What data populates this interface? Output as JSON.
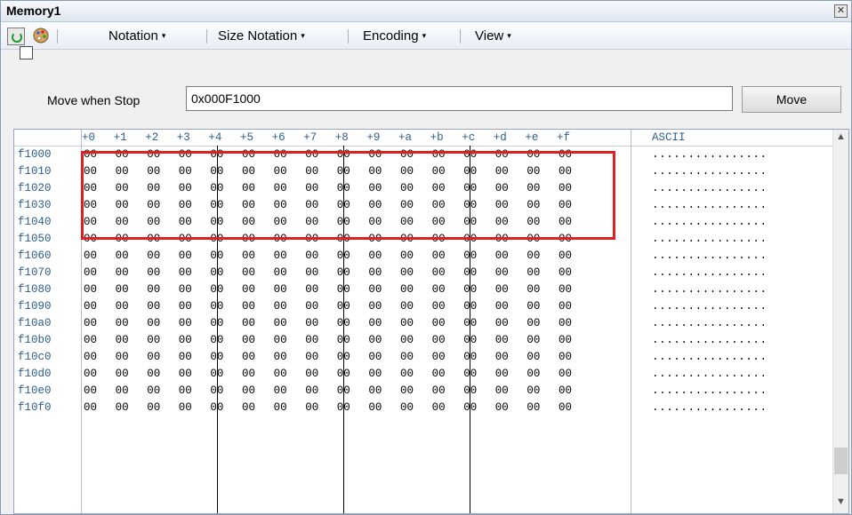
{
  "window": {
    "title": "Memory1"
  },
  "toolbar": {
    "icons": [
      "refresh-icon",
      "palette-icon"
    ],
    "menus": [
      {
        "label": "Notation",
        "arrow": "▾"
      },
      {
        "label": "Size Notation",
        "arrow": "▾"
      },
      {
        "label": "Encoding",
        "arrow": "▾"
      },
      {
        "label": "View",
        "arrow": "▾"
      }
    ]
  },
  "addressbar": {
    "checkbox_label": "Move when Stop",
    "checkbox_checked": false,
    "address_value": "0x000F1000",
    "move_button": "Move"
  },
  "grid": {
    "offset_headers": [
      "+0",
      "+1",
      "+2",
      "+3",
      "+4",
      "+5",
      "+6",
      "+7",
      "+8",
      "+9",
      "+a",
      "+b",
      "+c",
      "+d",
      "+e",
      "+f"
    ],
    "ascii_header": "ASCII",
    "rows": [
      {
        "address": "f1000",
        "bytes": [
          "00",
          "00",
          "00",
          "00",
          "00",
          "00",
          "00",
          "00",
          "00",
          "00",
          "00",
          "00",
          "00",
          "00",
          "00",
          "00"
        ],
        "ascii": "................"
      },
      {
        "address": "f1010",
        "bytes": [
          "00",
          "00",
          "00",
          "00",
          "00",
          "00",
          "00",
          "00",
          "00",
          "00",
          "00",
          "00",
          "00",
          "00",
          "00",
          "00"
        ],
        "ascii": "................"
      },
      {
        "address": "f1020",
        "bytes": [
          "00",
          "00",
          "00",
          "00",
          "00",
          "00",
          "00",
          "00",
          "00",
          "00",
          "00",
          "00",
          "00",
          "00",
          "00",
          "00"
        ],
        "ascii": "................"
      },
      {
        "address": "f1030",
        "bytes": [
          "00",
          "00",
          "00",
          "00",
          "00",
          "00",
          "00",
          "00",
          "00",
          "00",
          "00",
          "00",
          "00",
          "00",
          "00",
          "00"
        ],
        "ascii": "................"
      },
      {
        "address": "f1040",
        "bytes": [
          "00",
          "00",
          "00",
          "00",
          "00",
          "00",
          "00",
          "00",
          "00",
          "00",
          "00",
          "00",
          "00",
          "00",
          "00",
          "00"
        ],
        "ascii": "................"
      },
      {
        "address": "f1050",
        "bytes": [
          "00",
          "00",
          "00",
          "00",
          "00",
          "00",
          "00",
          "00",
          "00",
          "00",
          "00",
          "00",
          "00",
          "00",
          "00",
          "00"
        ],
        "ascii": "................"
      },
      {
        "address": "f1060",
        "bytes": [
          "00",
          "00",
          "00",
          "00",
          "00",
          "00",
          "00",
          "00",
          "00",
          "00",
          "00",
          "00",
          "00",
          "00",
          "00",
          "00"
        ],
        "ascii": "................"
      },
      {
        "address": "f1070",
        "bytes": [
          "00",
          "00",
          "00",
          "00",
          "00",
          "00",
          "00",
          "00",
          "00",
          "00",
          "00",
          "00",
          "00",
          "00",
          "00",
          "00"
        ],
        "ascii": "................"
      },
      {
        "address": "f1080",
        "bytes": [
          "00",
          "00",
          "00",
          "00",
          "00",
          "00",
          "00",
          "00",
          "00",
          "00",
          "00",
          "00",
          "00",
          "00",
          "00",
          "00"
        ],
        "ascii": "................"
      },
      {
        "address": "f1090",
        "bytes": [
          "00",
          "00",
          "00",
          "00",
          "00",
          "00",
          "00",
          "00",
          "00",
          "00",
          "00",
          "00",
          "00",
          "00",
          "00",
          "00"
        ],
        "ascii": "................"
      },
      {
        "address": "f10a0",
        "bytes": [
          "00",
          "00",
          "00",
          "00",
          "00",
          "00",
          "00",
          "00",
          "00",
          "00",
          "00",
          "00",
          "00",
          "00",
          "00",
          "00"
        ],
        "ascii": "................"
      },
      {
        "address": "f10b0",
        "bytes": [
          "00",
          "00",
          "00",
          "00",
          "00",
          "00",
          "00",
          "00",
          "00",
          "00",
          "00",
          "00",
          "00",
          "00",
          "00",
          "00"
        ],
        "ascii": "................"
      },
      {
        "address": "f10c0",
        "bytes": [
          "00",
          "00",
          "00",
          "00",
          "00",
          "00",
          "00",
          "00",
          "00",
          "00",
          "00",
          "00",
          "00",
          "00",
          "00",
          "00"
        ],
        "ascii": "................"
      },
      {
        "address": "f10d0",
        "bytes": [
          "00",
          "00",
          "00",
          "00",
          "00",
          "00",
          "00",
          "00",
          "00",
          "00",
          "00",
          "00",
          "00",
          "00",
          "00",
          "00"
        ],
        "ascii": "................"
      },
      {
        "address": "f10e0",
        "bytes": [
          "00",
          "00",
          "00",
          "00",
          "00",
          "00",
          "00",
          "00",
          "00",
          "00",
          "00",
          "00",
          "00",
          "00",
          "00",
          "00"
        ],
        "ascii": "................"
      },
      {
        "address": "f10f0",
        "bytes": [
          "00",
          "00",
          "00",
          "00",
          "00",
          "00",
          "00",
          "00",
          "00",
          "00",
          "00",
          "00",
          "00",
          "00",
          "00",
          "00"
        ],
        "ascii": "................"
      }
    ]
  },
  "highlight": {
    "color": "#e02020",
    "rows_covered": [
      "f1000",
      "f1010",
      "f1020",
      "f1030"
    ]
  },
  "scrollbar": {
    "up_arrow": "▲",
    "down_arrow": "▼"
  }
}
